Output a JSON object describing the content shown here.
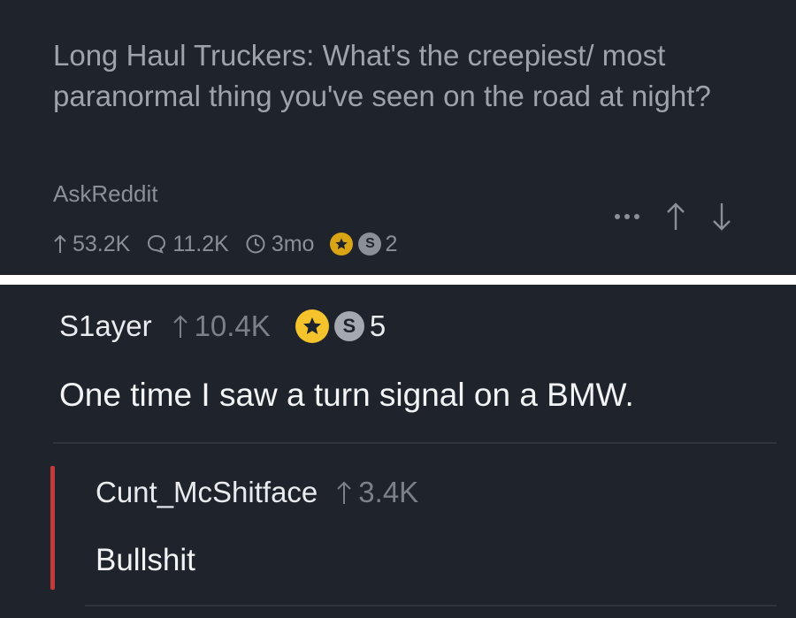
{
  "post": {
    "title": "Long Haul Truckers: What's the creepiest/ most paranormal thing you've seen on the road at night?",
    "subreddit": "AskReddit",
    "upvotes": "53.2K",
    "comments": "11.2K",
    "age": "3mo",
    "silver_count": "2",
    "icons": [
      "arrow-up-icon",
      "comment-icon",
      "clock-icon",
      "gold-award-icon",
      "silver-award-icon",
      "more-icon",
      "upvote-icon",
      "downvote-icon"
    ]
  },
  "comment": {
    "author": "S1ayer",
    "score": "10.4K",
    "silver_count": "5",
    "body": "One time I saw a turn signal on a BMW."
  },
  "reply": {
    "author": "Cunt_McShitface",
    "score": "3.4K",
    "body": "Bullshit"
  },
  "colors": {
    "background": "#1f232b",
    "gold": "#f5c32b",
    "reply_bar": "#c23a3a"
  }
}
